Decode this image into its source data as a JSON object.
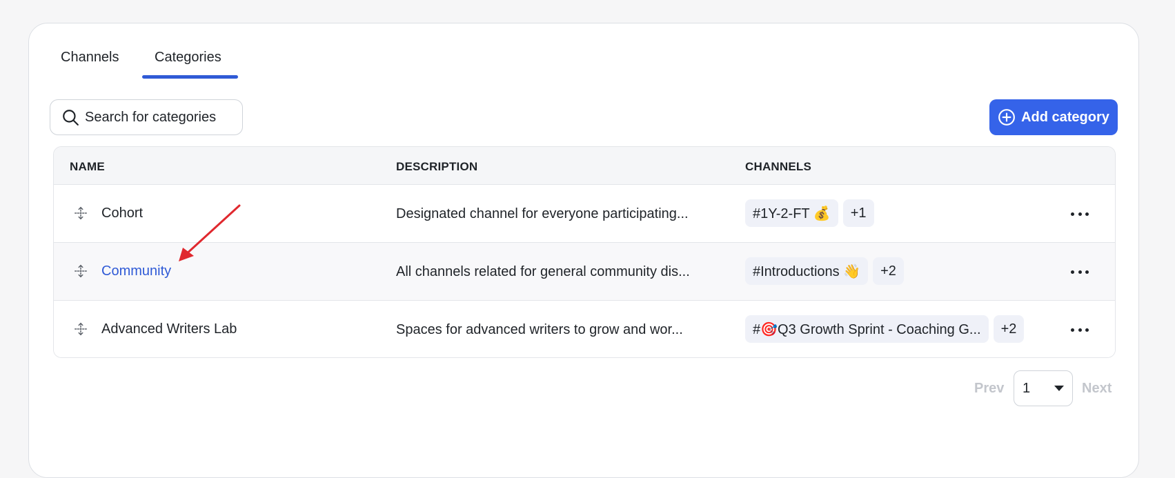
{
  "tabs": [
    {
      "label": "Channels",
      "active": false
    },
    {
      "label": "Categories",
      "active": true
    }
  ],
  "search": {
    "placeholder": "Search for categories",
    "icon": "search-icon"
  },
  "add_button": {
    "label": "Add category",
    "icon": "plus-circle-icon"
  },
  "table": {
    "headers": {
      "name": "NAME",
      "description": "DESCRIPTION",
      "channels": "CHANNELS"
    },
    "rows": [
      {
        "name": "Cohort",
        "description": "Designated channel for everyone participating...",
        "channels": [
          "#1Y-2-FT 💰"
        ],
        "more_count": "+1"
      },
      {
        "name": "Community",
        "description": "All channels related for general community dis...",
        "channels": [
          "#Introductions 👋"
        ],
        "more_count": "+2"
      },
      {
        "name": "Advanced Writers Lab",
        "description": "Spaces for advanced writers to grow and wor...",
        "channels": [
          "#🎯Q3 Growth Sprint - Coaching G..."
        ],
        "more_count": "+2"
      }
    ]
  },
  "pagination": {
    "prev": "Prev",
    "page": "1",
    "next": "Next"
  },
  "colors": {
    "accent": "#3563e9",
    "link": "#2f5ad6",
    "annotation_arrow": "#e0282e"
  }
}
